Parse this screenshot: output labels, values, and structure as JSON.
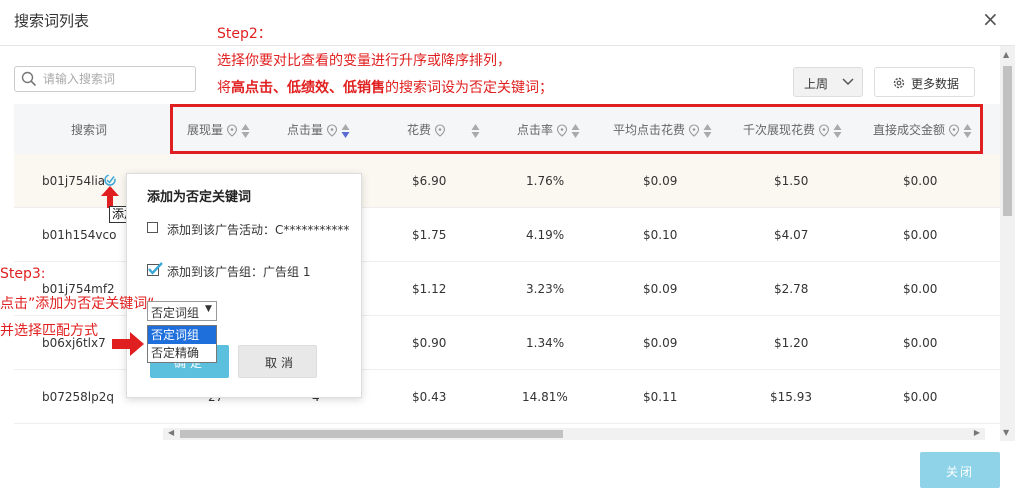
{
  "dialog": {
    "title": "搜索词列表",
    "close_glyph": "×"
  },
  "search": {
    "placeholder": "请输入搜索词"
  },
  "period": {
    "value": "上周"
  },
  "more_data": {
    "label": "更多数据"
  },
  "annotations": {
    "step2_title": "Step2：",
    "step2_line1": "选择你要对比查看的变量进行升序或降序排列，",
    "step2_line2_a": "将",
    "step2_line2_b": "高点击、低绩效、低销售",
    "step2_line2_c": "的搜索词设为否定关键词；",
    "step3_title": "Step3:",
    "step3_line1": "点击”添加为否定关键词“",
    "step3_line2": "并选择匹配方式"
  },
  "table": {
    "columns": [
      "搜索词",
      "展现量",
      "点击量",
      "花费",
      "点击率",
      "平均点击花费",
      "千次展现花费",
      "直接成交金额"
    ],
    "rows": [
      {
        "term": "b01j754lia",
        "impr": "",
        "clicks": "",
        "cost": "$6.90",
        "ctr": "1.76%",
        "cpc": "$0.09",
        "cpm": "$1.50",
        "sales": "$0.00"
      },
      {
        "term": "b01h154vco",
        "impr": "",
        "clicks": "",
        "cost": "$1.75",
        "ctr": "4.19%",
        "cpc": "$0.10",
        "cpm": "$4.07",
        "sales": "$0.00"
      },
      {
        "term": "b01j754mf2",
        "impr": "",
        "clicks": "",
        "cost": "$1.12",
        "ctr": "3.23%",
        "cpc": "$0.09",
        "cpm": "$2.78",
        "sales": "$0.00"
      },
      {
        "term": "b06xj6tlx7",
        "impr": "",
        "clicks": "",
        "cost": "$0.90",
        "ctr": "1.34%",
        "cpc": "$0.09",
        "cpm": "$1.20",
        "sales": "$0.00"
      },
      {
        "term": "b07258lp2q",
        "impr": "27",
        "clicks": "4",
        "cost": "$0.43",
        "ctr": "14.81%",
        "cpc": "$0.11",
        "cpm": "$15.93",
        "sales": "$0.00"
      }
    ]
  },
  "popup": {
    "title": "添加为否定关键词",
    "opt1_label": "添加到该广告活动：C***********",
    "opt2_label": "添加到该广告组：广告组 1",
    "select_value": "否定词组",
    "select_arrow": "▼",
    "options": [
      "否定词组",
      "否定精确"
    ],
    "ok_label": "确定",
    "cancel_label": "取消"
  },
  "tooltip": "添加为否定关键词",
  "footer": {
    "close_label": "关闭"
  },
  "colors": {
    "accent": "#5bc0de",
    "annotation": "#e02020",
    "sort_active": "#5b6bd6"
  }
}
